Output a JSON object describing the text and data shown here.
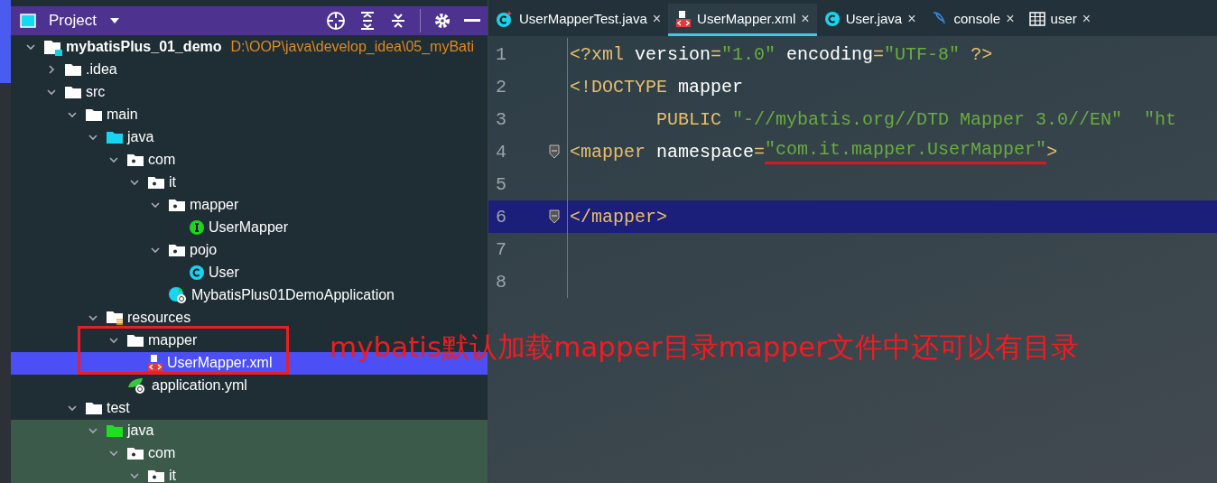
{
  "project_panel": {
    "title": "Project",
    "tree": [
      {
        "label": "mybatisPlus_01_demo",
        "kind": "module",
        "path": "D:\\OOP\\java\\develop_idea\\05_myBati",
        "expanded": true,
        "selected": false,
        "children": [
          {
            "label": ".idea",
            "kind": "folder",
            "expanded": false,
            "selected": false
          },
          {
            "label": "src",
            "kind": "folder",
            "expanded": true,
            "selected": false,
            "children": [
              {
                "label": "main",
                "kind": "folder",
                "expanded": true,
                "selected": false,
                "children": [
                  {
                    "label": "java",
                    "kind": "source",
                    "expanded": true,
                    "selected": false,
                    "children": [
                      {
                        "label": "com",
                        "kind": "package",
                        "expanded": true,
                        "selected": false,
                        "children": [
                          {
                            "label": "it",
                            "kind": "package",
                            "expanded": true,
                            "selected": false,
                            "children": [
                              {
                                "label": "mapper",
                                "kind": "package",
                                "expanded": true,
                                "selected": false,
                                "children": [
                                  {
                                    "label": "UserMapper",
                                    "kind": "interface",
                                    "selected": false
                                  }
                                ]
                              },
                              {
                                "label": "pojo",
                                "kind": "package",
                                "expanded": true,
                                "selected": false,
                                "children": [
                                  {
                                    "label": "User",
                                    "kind": "class",
                                    "selected": false
                                  }
                                ]
                              },
                              {
                                "label": "MybatisPlus01DemoApplication",
                                "kind": "spring-class",
                                "selected": false
                              }
                            ]
                          }
                        ]
                      }
                    ]
                  },
                  {
                    "label": "resources",
                    "kind": "resources",
                    "expanded": true,
                    "selected": false,
                    "children": [
                      {
                        "label": "mapper",
                        "kind": "folder",
                        "expanded": true,
                        "selected": false,
                        "children": [
                          {
                            "label": "UserMapper.xml",
                            "kind": "xml",
                            "selected": true
                          }
                        ]
                      },
                      {
                        "label": "application.yml",
                        "kind": "yml",
                        "selected": false
                      }
                    ]
                  }
                ]
              },
              {
                "label": "test",
                "kind": "folder",
                "expanded": true,
                "selected": false,
                "children": [
                  {
                    "label": "java",
                    "kind": "test-source",
                    "expanded": true,
                    "selected": false,
                    "tinted": true,
                    "children": [
                      {
                        "label": "com",
                        "kind": "package",
                        "expanded": true,
                        "selected": false,
                        "tinted": true,
                        "children": [
                          {
                            "label": "it",
                            "kind": "package",
                            "expanded": true,
                            "selected": false,
                            "tinted": true
                          }
                        ]
                      }
                    ]
                  }
                ]
              }
            ]
          }
        ]
      }
    ]
  },
  "editor": {
    "tabs": [
      {
        "label": "UserMapperTest.java",
        "kind": "test-class",
        "selected": false,
        "close": "×"
      },
      {
        "label": "UserMapper.xml",
        "kind": "xml",
        "selected": true,
        "close": "×"
      },
      {
        "label": "User.java",
        "kind": "class",
        "selected": false,
        "close": "×"
      },
      {
        "label": "console",
        "kind": "console",
        "selected": false,
        "close": "×"
      },
      {
        "label": "user",
        "kind": "table",
        "selected": false,
        "close": "×"
      }
    ],
    "lines": [
      {
        "number": "1",
        "current": false,
        "tokens": [
          {
            "kind": "tag",
            "text": "<?xml"
          },
          {
            "kind": "attr",
            "text": " version"
          },
          {
            "kind": "tag",
            "text": "="
          },
          {
            "kind": "value",
            "text": "\"1.0\""
          },
          {
            "kind": "attr",
            "text": " encoding"
          },
          {
            "kind": "tag",
            "text": "="
          },
          {
            "kind": "value",
            "text": "\"UTF-8\""
          },
          {
            "kind": "tag",
            "text": " ?>"
          }
        ]
      },
      {
        "number": "2",
        "current": false,
        "tokens": [
          {
            "kind": "tag",
            "text": "<!DOCTYPE"
          },
          {
            "kind": "attr",
            "text": " mapper"
          }
        ]
      },
      {
        "number": "3",
        "current": false,
        "tokens": [
          {
            "kind": "tag",
            "text": "        PUBLIC"
          },
          {
            "kind": "value",
            "text": " \"-//mybatis.org//DTD Mapper 3.0//EN\"  \"ht"
          }
        ]
      },
      {
        "number": "4",
        "current": false,
        "fold": true,
        "tokens": [
          {
            "kind": "tag",
            "text": "<mapper"
          },
          {
            "kind": "attr",
            "text": " namespace"
          },
          {
            "kind": "tag",
            "text": "="
          },
          {
            "kind": "value",
            "text": "\"com.it.mapper.UserMapper\"",
            "underlined": true
          },
          {
            "kind": "tag",
            "text": ">"
          }
        ]
      },
      {
        "number": "5",
        "current": false
      },
      {
        "number": "6",
        "current": true,
        "fold": true,
        "tokens": [
          {
            "kind": "tag",
            "text": "</mapper>"
          }
        ]
      },
      {
        "number": "7",
        "current": false
      },
      {
        "number": "8",
        "current": false
      }
    ]
  },
  "annotation": "mybatis默认加载mapper目录mapper文件中还可以有目录"
}
